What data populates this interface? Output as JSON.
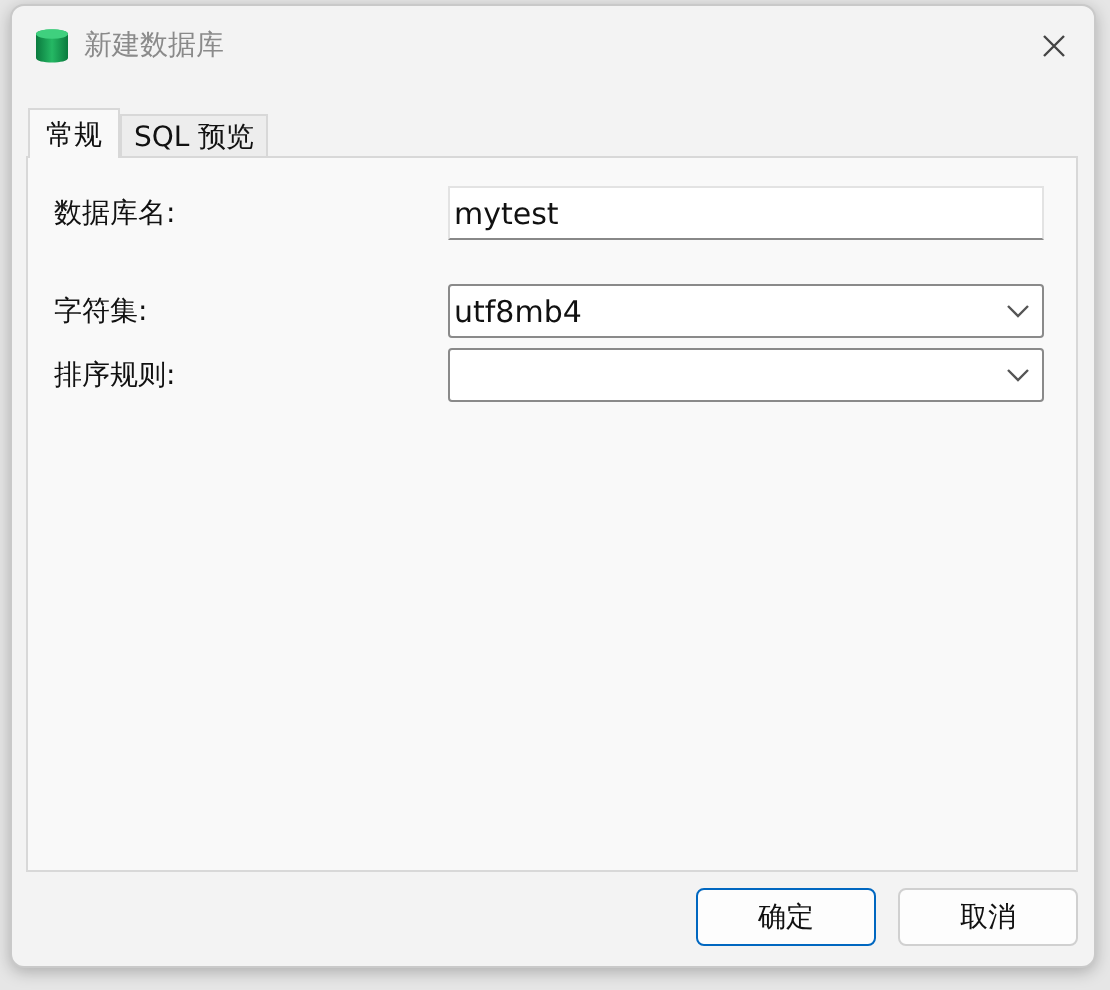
{
  "window": {
    "title": "新建数据库"
  },
  "tabs": [
    {
      "label": "常规",
      "selected": true
    },
    {
      "label": "SQL 预览",
      "selected": false
    }
  ],
  "fields": [
    {
      "kind": "text",
      "label": "数据库名:",
      "value": "mytest"
    },
    {
      "kind": "select",
      "label": "字符集:",
      "value": "utf8mb4"
    },
    {
      "kind": "select",
      "label": "排序规则:"
    }
  ],
  "buttons": [
    {
      "label": "确定",
      "default": true
    },
    {
      "label": "取消",
      "default": false
    }
  ]
}
